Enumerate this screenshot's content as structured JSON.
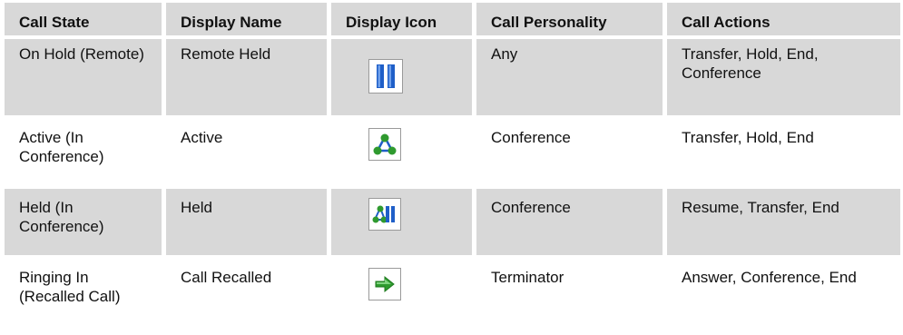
{
  "headers": [
    "Call State",
    "Display Name",
    "Display Icon",
    "Call Personality",
    "Call Actions"
  ],
  "rows": [
    {
      "call_state": "On Hold (Remote)",
      "display_name": "Remote Held",
      "icon": "pause-icon",
      "call_personality": "Any",
      "call_actions": "Transfer, Hold, End, Conference"
    },
    {
      "call_state": "Active (In Conference)",
      "display_name": "Active",
      "icon": "conference-icon",
      "call_personality": "Conference",
      "call_actions": "Transfer, Hold, End"
    },
    {
      "call_state": "Held (In Conference)",
      "display_name": "Held",
      "icon": "conference-held-icon",
      "call_personality": "Conference",
      "call_actions": "Resume, Transfer, End"
    },
    {
      "call_state": "Ringing In (Recalled Call)",
      "display_name": "Call Recalled",
      "icon": "arrow-right-icon",
      "call_personality": "Terminator",
      "call_actions": "Answer, Conference, End"
    }
  ],
  "colors": {
    "row_gray": "#d8d8d8",
    "icon_blue": "#1f5fc8",
    "icon_green": "#2f9a2f"
  }
}
